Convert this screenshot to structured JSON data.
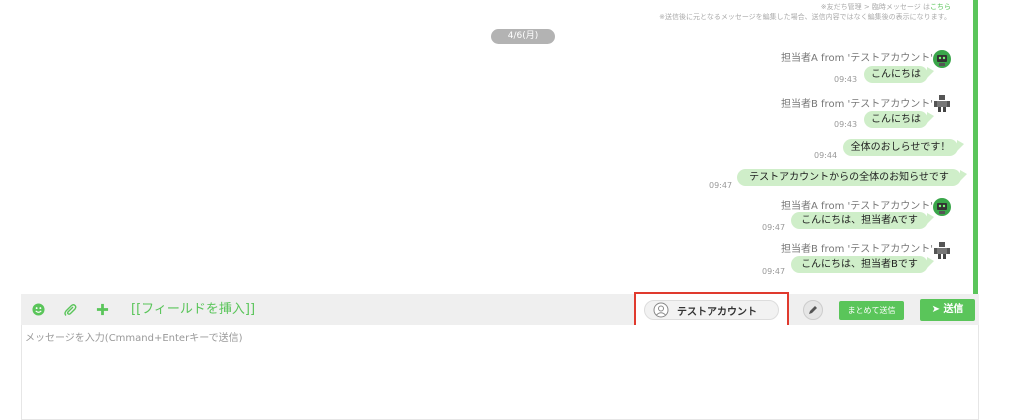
{
  "notices": {
    "line1_text": "※友だち管理 > 臨時メッセージ は",
    "line1_link": "こちら",
    "line2": "※送信後に元となるメッセージを編集した場合、送信内容ではなく編集後の表示になります。"
  },
  "date_divider": "4/6(月)",
  "messages": [
    {
      "sender": "担当者A from 'テストアカウント'",
      "time": "09:43",
      "text": "こんにちは",
      "avatar": "robot-icon"
    },
    {
      "sender": "担当者B from 'テストアカウント'",
      "time": "09:43",
      "text": "こんにちは",
      "avatar": "robot-icon"
    },
    {
      "sender": "",
      "time": "09:44",
      "text": "全体のおしらせです！",
      "avatar": ""
    },
    {
      "sender": "",
      "time": "09:47",
      "text": "テストアカウントからの全体のお知らせです",
      "avatar": ""
    },
    {
      "sender": "担当者A from 'テストアカウント'",
      "time": "09:47",
      "text": "こんにちは、担当者Aです",
      "avatar": "robot-icon"
    },
    {
      "sender": "担当者B from 'テストアカウント'",
      "time": "09:47",
      "text": "こんにちは、担当者Bです",
      "avatar": "robot-icon"
    }
  ],
  "toolbar": {
    "icons": [
      "emoji-icon",
      "paperclip-icon",
      "plus-icon"
    ],
    "insert_field_label": "[[フィールドを挿入]]",
    "account_label": "テストアカウント",
    "bulk_send_label": "まとめて送信",
    "send_label": "送信"
  },
  "input": {
    "placeholder": "メッセージを入力(Cmmand+Enterキーで送信)"
  },
  "colors": {
    "accent": "#5ac55a",
    "bubble": "#cfeec9",
    "highlight_border": "#e03a2e"
  }
}
